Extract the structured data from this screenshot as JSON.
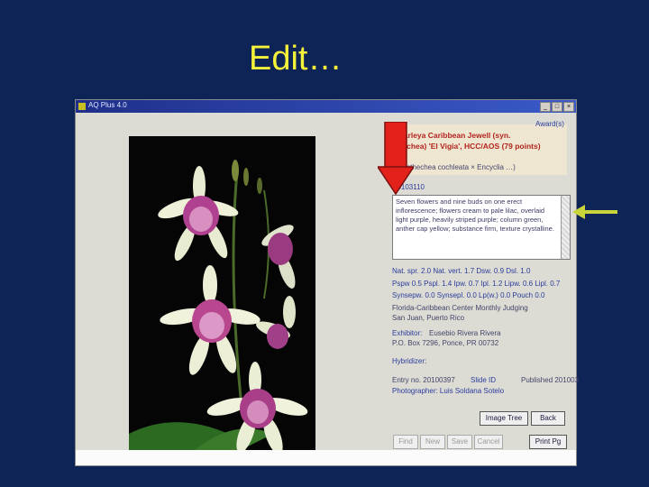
{
  "slide": {
    "title": "Edit…"
  },
  "window": {
    "title": "AQ Plus 4.0",
    "controls": [
      "_",
      "□",
      "×"
    ]
  },
  "award": {
    "header": "Award(s)",
    "name_line1": "Guarleya Caribbean Jewell (syn.",
    "name_line2": "Seychea) 'El Vigia', HCC/AOS (79 points)",
    "parentage": "(Prosthechea cochleata × Encyclia …)",
    "award_number": "20103110"
  },
  "description": {
    "text": "Seven flowers and nine buds on one erect inflorescence; flowers cream to pale lilac, overlaid light purple, heavily striped purple; column green, anther cap yellow; substance firm, texture crystalline."
  },
  "measurements": {
    "row1": "Nat. spr. 2.0  Nat. vert. 1.7  Dsw. 0.9  Dsl. 1.0",
    "row2": "Pspw 0.5  Pspl. 1.4  Ipw. 0.7  Ipl. 1.2  Lipw. 0.6  Lipl. 0.7",
    "row3": "Synsepw. 0.0  Synsepl. 0.0  Lp(w.) 0.0  Pouch 0.0"
  },
  "judging": {
    "line1": "Florida-Caribbean Center Monthly Judging",
    "line2": "San Juan, Puerto Rico"
  },
  "exhibitor": {
    "label": "Exhibitor:",
    "name": "Eusebio Rivera Rivera",
    "address": "P.O. Box 7296, Ponce, PR 00732"
  },
  "hybridizer": {
    "label": "Hybridizer:"
  },
  "entry": {
    "entry_label": "Entry no. 20100397",
    "slide_label": "Slide ID",
    "published": "Published 201003"
  },
  "photographer": {
    "text": "Photographer: Luis Soldana Sotelo"
  },
  "buttons": {
    "image_tree": "Image Tree",
    "back": "Back",
    "find": "Find",
    "new": "New",
    "save": "Save",
    "cancel": "Cancel",
    "print_pg": "Print Pg"
  },
  "colors": {
    "slide_background": "#0e2356",
    "title_yellow": "#f5f03a",
    "award_red": "#b2241c",
    "link_blue": "#2b3c9c",
    "arrow_red": "#e2211b",
    "arrow_green": "#c8d43a"
  },
  "icons": [
    "red-down-arrow-icon",
    "green-left-arrow-icon",
    "app-icon"
  ]
}
